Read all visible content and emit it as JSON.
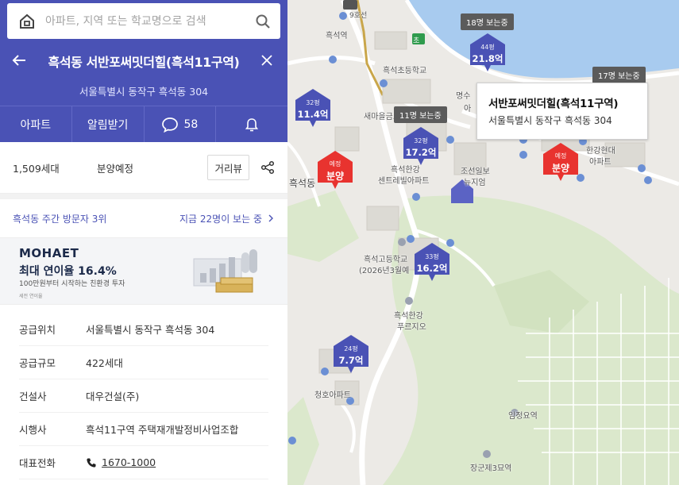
{
  "search": {
    "placeholder": "아파트, 지역 또는 학교명으로 검색"
  },
  "detail": {
    "title": "흑석동 서반포써밋더힐(흑석11구역)",
    "address": "서울특별시 동작구 흑석동 304"
  },
  "tabs": {
    "apartment": "아파트",
    "notify": "알림받기",
    "comment_count": "58"
  },
  "summary": {
    "households": "1,509세대",
    "status": "분양예정",
    "distance_view": "거리뷰"
  },
  "visitors": {
    "weekly": "흑석동 주간 방문자 3위",
    "now_viewing": "지금 22명이 보는 중"
  },
  "ad": {
    "logo": "MOHAET",
    "rate": "최대 연이율 16.4%",
    "desc": "100만원부터 시작하는 친환경 투자",
    "note": "세전 연이율"
  },
  "info": [
    {
      "label": "공급위치",
      "value": "서울특별시 동작구 흑석동 304"
    },
    {
      "label": "공급규모",
      "value": "422세대"
    },
    {
      "label": "건설사",
      "value": "대우건설(주)"
    },
    {
      "label": "시행사",
      "value": "흑석11구역 주택재개발정비사업조합"
    },
    {
      "label": "대표전화",
      "value": "1670-1000"
    }
  ],
  "map": {
    "markers": [
      {
        "area": "32평",
        "price": "11.4억"
      },
      {
        "area": "32평",
        "price": "17.2억"
      },
      {
        "area": "44평",
        "price": "21.8억"
      },
      {
        "area": "33평",
        "price": "16.2억"
      },
      {
        "area": "24평",
        "price": "7.7억"
      },
      {
        "area": "예정",
        "price": "분양"
      },
      {
        "area": "예정",
        "price": "분양"
      }
    ],
    "badges": [
      "18명 보는중",
      "17명 보는중",
      "11명 보는중"
    ],
    "labels": {
      "heukseok_station": "흑석역",
      "line9": "9호선",
      "school_elem": "흑석초등학교",
      "semaul": "새마을금고",
      "myungsoo": "명수",
      "apt_abbr": "아",
      "central": "흑석한강",
      "central2": "센트레빌아파트",
      "chosun": "조선일보",
      "chosun2": "뉴지엄",
      "hangang_hd": "한강현대",
      "apt": "아파트",
      "heukseok_dong": "흑석동",
      "high_school": "흑석고등학교",
      "high_school2": "(2026년3월예",
      "prugio": "흑석한강",
      "prugio2": "푸르지오",
      "cheongho": "청호아파트",
      "imjeong": "임정요역",
      "janggun": "장군제3묘역",
      "school_badge": "초"
    },
    "tooltip": {
      "title": "서반포써밋더힐(흑석11구역)",
      "address": "서울특별시 동작구 흑석동 304"
    },
    "colors": {
      "marker": "#4a52b5",
      "sale": "#e8332f",
      "river": "#a8cbef",
      "green": "#dbe8cc"
    }
  }
}
